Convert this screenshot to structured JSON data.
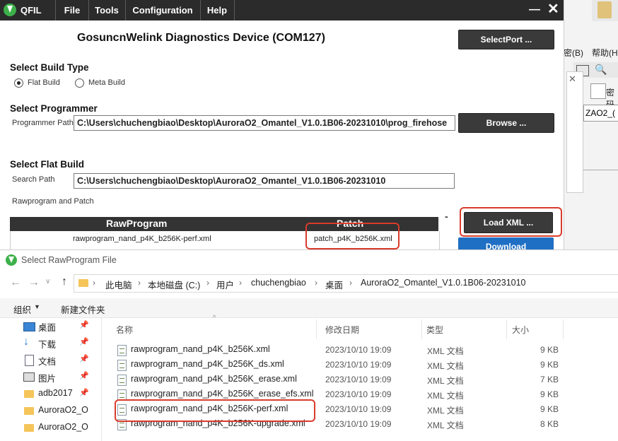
{
  "background_window": {
    "menu_partial": "密(B)",
    "help_partial": "帮助(H",
    "field_partial": "密码",
    "text_partial": "ZAO2_("
  },
  "qfil": {
    "app_name": "QFIL",
    "menu": [
      "File",
      "Tools",
      "Configuration",
      "Help"
    ],
    "minimize_glyph": "—",
    "close_glyph": "✕",
    "device_title": "GosuncnWelink Diagnostics Device (COM127)",
    "select_port_label": "SelectPort ...",
    "build_type": {
      "heading": "Select Build Type",
      "options": [
        "Flat Build",
        "Meta Build"
      ],
      "selected": "Flat Build"
    },
    "programmer": {
      "heading": "Select Programmer",
      "path_label": "Programmer Path",
      "path_value": "C:\\Users\\chuchengbiao\\Desktop\\AuroraO2_Omantel_V1.0.1B06-20231010\\prog_firehose",
      "browse_label": "Browse ..."
    },
    "flat_build": {
      "heading": "Select Flat Build",
      "search_label": "Search Path",
      "search_value": "C:\\Users\\chuchengbiao\\Desktop\\AuroraO2_Omantel_V1.0.1B06-20231010",
      "raw_patch_label": "Rawprogram and Patch",
      "dash": "-",
      "table_headers": [
        "RawProgram",
        "Patch"
      ],
      "row": {
        "rawprogram": "rawprogram_nand_p4K_b256K-perf.xml",
        "patch": "patch_p4K_b256K.xml"
      }
    },
    "load_xml_label": "Load XML ...",
    "download_label": "Download"
  },
  "dialog": {
    "title": "Select RawProgram File",
    "breadcrumb": [
      "此电脑",
      "本地磁盘 (C:)",
      "用户",
      "chuchengbiao",
      "桌面",
      "AuroraO2_Omantel_V1.0.1B06-20231010"
    ],
    "organize_label": "组织",
    "new_folder_label": "新建文件夹",
    "sidebar": [
      {
        "label": "桌面",
        "icon": "desktop-icon",
        "pinned": true
      },
      {
        "label": "下载",
        "icon": "download-icon",
        "pinned": true
      },
      {
        "label": "文档",
        "icon": "document-icon",
        "pinned": true
      },
      {
        "label": "图片",
        "icon": "picture-icon",
        "pinned": true
      },
      {
        "label": "adb2017",
        "icon": "folder-icon",
        "pinned": true
      },
      {
        "label": "AuroraO2_O",
        "icon": "folder-icon",
        "pinned": false
      },
      {
        "label": "AuroraO2_O",
        "icon": "folder-icon",
        "pinned": false
      }
    ],
    "columns": [
      "名称",
      "修改日期",
      "类型",
      "大小"
    ],
    "files": [
      {
        "name": "rawprogram_nand_p4K_b256K.xml",
        "date": "2023/10/10 19:09",
        "type": "XML 文档",
        "size": "9 KB"
      },
      {
        "name": "rawprogram_nand_p4K_b256K_ds.xml",
        "date": "2023/10/10 19:09",
        "type": "XML 文档",
        "size": "9 KB"
      },
      {
        "name": "rawprogram_nand_p4K_b256K_erase.xml",
        "date": "2023/10/10 19:09",
        "type": "XML 文档",
        "size": "7 KB"
      },
      {
        "name": "rawprogram_nand_p4K_b256K_erase_efs.xml",
        "date": "2023/10/10 19:09",
        "type": "XML 文档",
        "size": "9 KB"
      },
      {
        "name": "rawprogram_nand_p4K_b256K-perf.xml",
        "date": "2023/10/10 19:09",
        "type": "XML 文档",
        "size": "9 KB"
      },
      {
        "name": "rawprogram_nand_p4K_b256K-upgrade.xml",
        "date": "2023/10/10 19:09",
        "type": "XML 文档",
        "size": "8 KB"
      }
    ],
    "highlighted_file": "rawprogram_nand_p4K_b256K-perf.xml"
  },
  "colors": {
    "menubar": "#2b2b2b",
    "button_dark": "#3a3a3a",
    "download_blue": "#1f6fc4",
    "highlight_red": "#d93b2b"
  }
}
